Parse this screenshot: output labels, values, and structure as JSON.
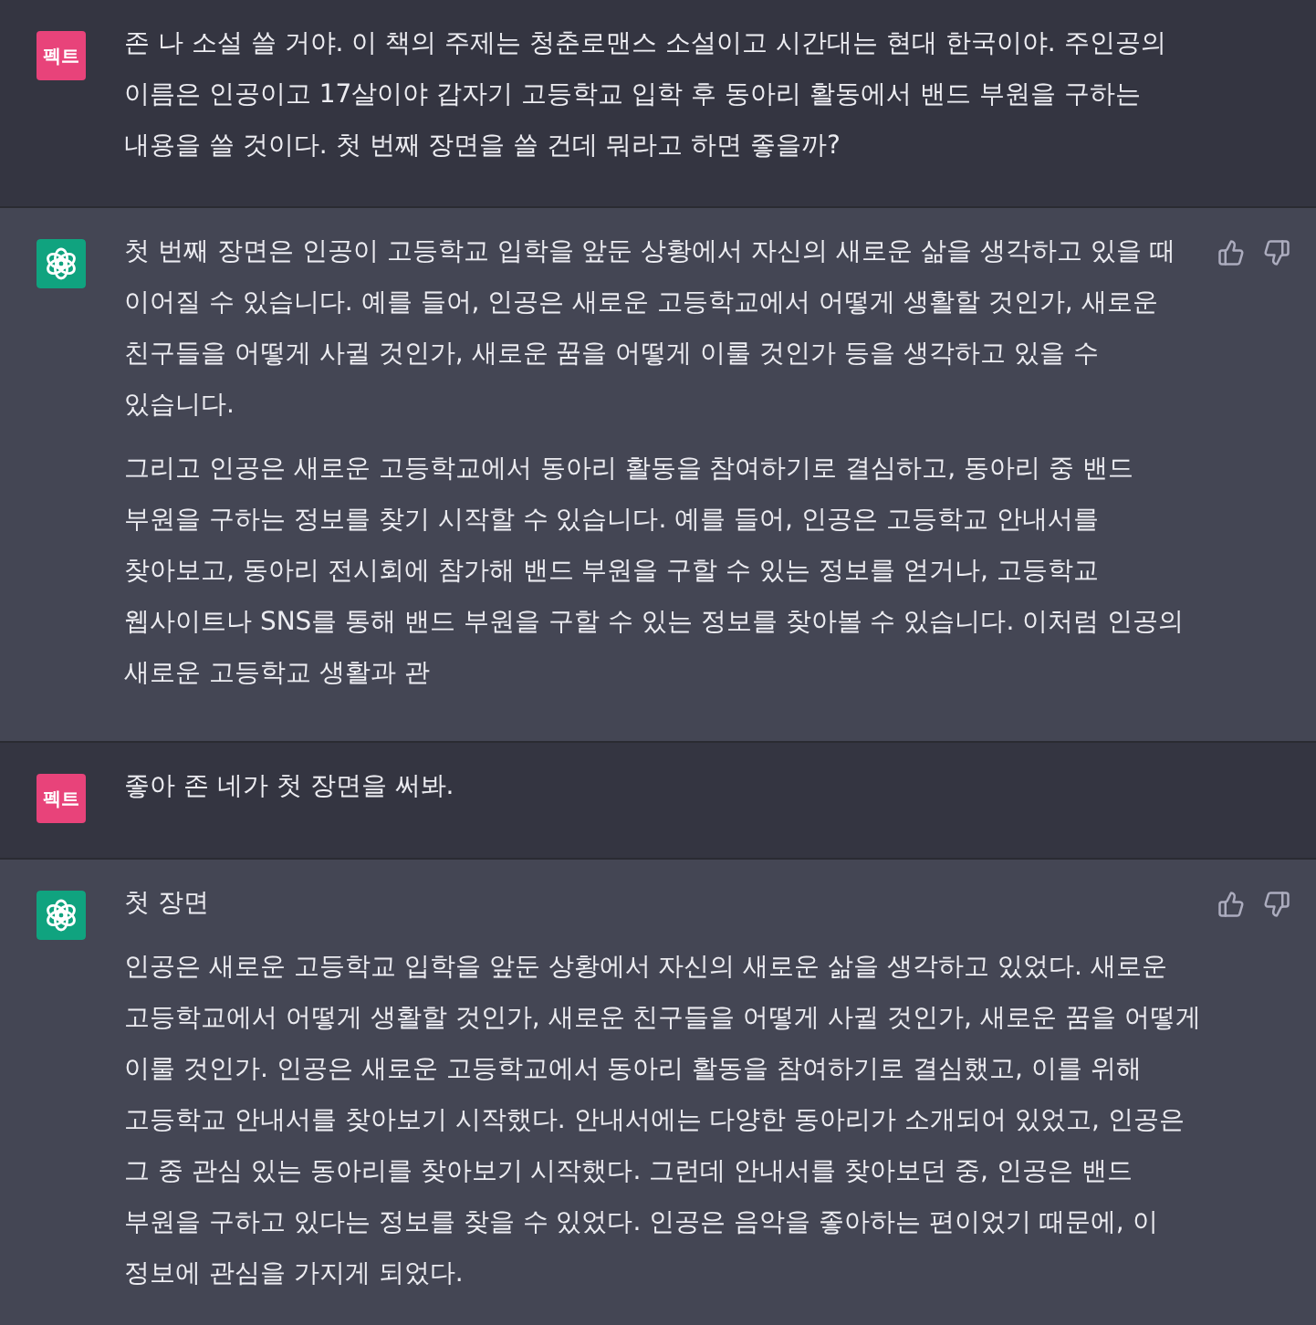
{
  "messages": [
    {
      "kind": "user",
      "avatar": "펙트",
      "paragraphs": [
        "존 나 소설 쓸 거야. 이 책의 주제는 청춘로맨스 소설이고 시간대는 현대 한국이야. 주인공의 이름은 인공이고 17살이야 갑자기 고등학교 입학 후 동아리 활동에서 밴드 부원을 구하는 내용을 쓸 것이다. 첫 번째 장면을 쓸 건데 뭐라고 하면 좋을까?"
      ]
    },
    {
      "kind": "assistant",
      "paragraphs": [
        "첫 번째 장면은 인공이 고등학교 입학을 앞둔 상황에서 자신의 새로운 삶을 생각하고 있을 때 이어질 수 있습니다. 예를 들어, 인공은 새로운 고등학교에서 어떻게 생활할 것인가, 새로운 친구들을 어떻게 사귈 것인가, 새로운 꿈을 어떻게 이룰 것인가 등을 생각하고 있을 수 있습니다.",
        "그리고 인공은 새로운 고등학교에서 동아리 활동을 참여하기로 결심하고, 동아리 중 밴드 부원을 구하는 정보를 찾기 시작할 수 있습니다. 예를 들어, 인공은 고등학교 안내서를 찾아보고, 동아리 전시회에 참가해 밴드 부원을 구할 수 있는 정보를 얻거나, 고등학교 웹사이트나 SNS를 통해 밴드 부원을 구할 수 있는 정보를 찾아볼 수 있습니다. 이처럼 인공의 새로운 고등학교 생활과 관"
      ]
    },
    {
      "kind": "user",
      "avatar": "펙트",
      "paragraphs": [
        "좋아 존 네가 첫 장면을 써봐."
      ]
    },
    {
      "kind": "assistant",
      "paragraphs": [
        "첫 장면",
        "인공은 새로운 고등학교 입학을 앞둔 상황에서 자신의 새로운 삶을 생각하고 있었다. 새로운 고등학교에서 어떻게 생활할 것인가, 새로운 친구들을 어떻게 사귈 것인가, 새로운 꿈을 어떻게 이룰 것인가. 인공은 새로운 고등학교에서 동아리 활동을 참여하기로 결심했고, 이를 위해 고등학교 안내서를 찾아보기 시작했다. 안내서에는 다양한 동아리가 소개되어 있었고, 인공은 그 중 관심 있는 동아리를 찾아보기 시작했다. 그런데 안내서를 찾아보던 중, 인공은 밴드 부원을 구하고 있다는 정보를 찾을 수 있었다. 인공은 음악을 좋아하는 편이었기 때문에, 이 정보에 관심을 가지게 되었다."
      ]
    }
  ]
}
